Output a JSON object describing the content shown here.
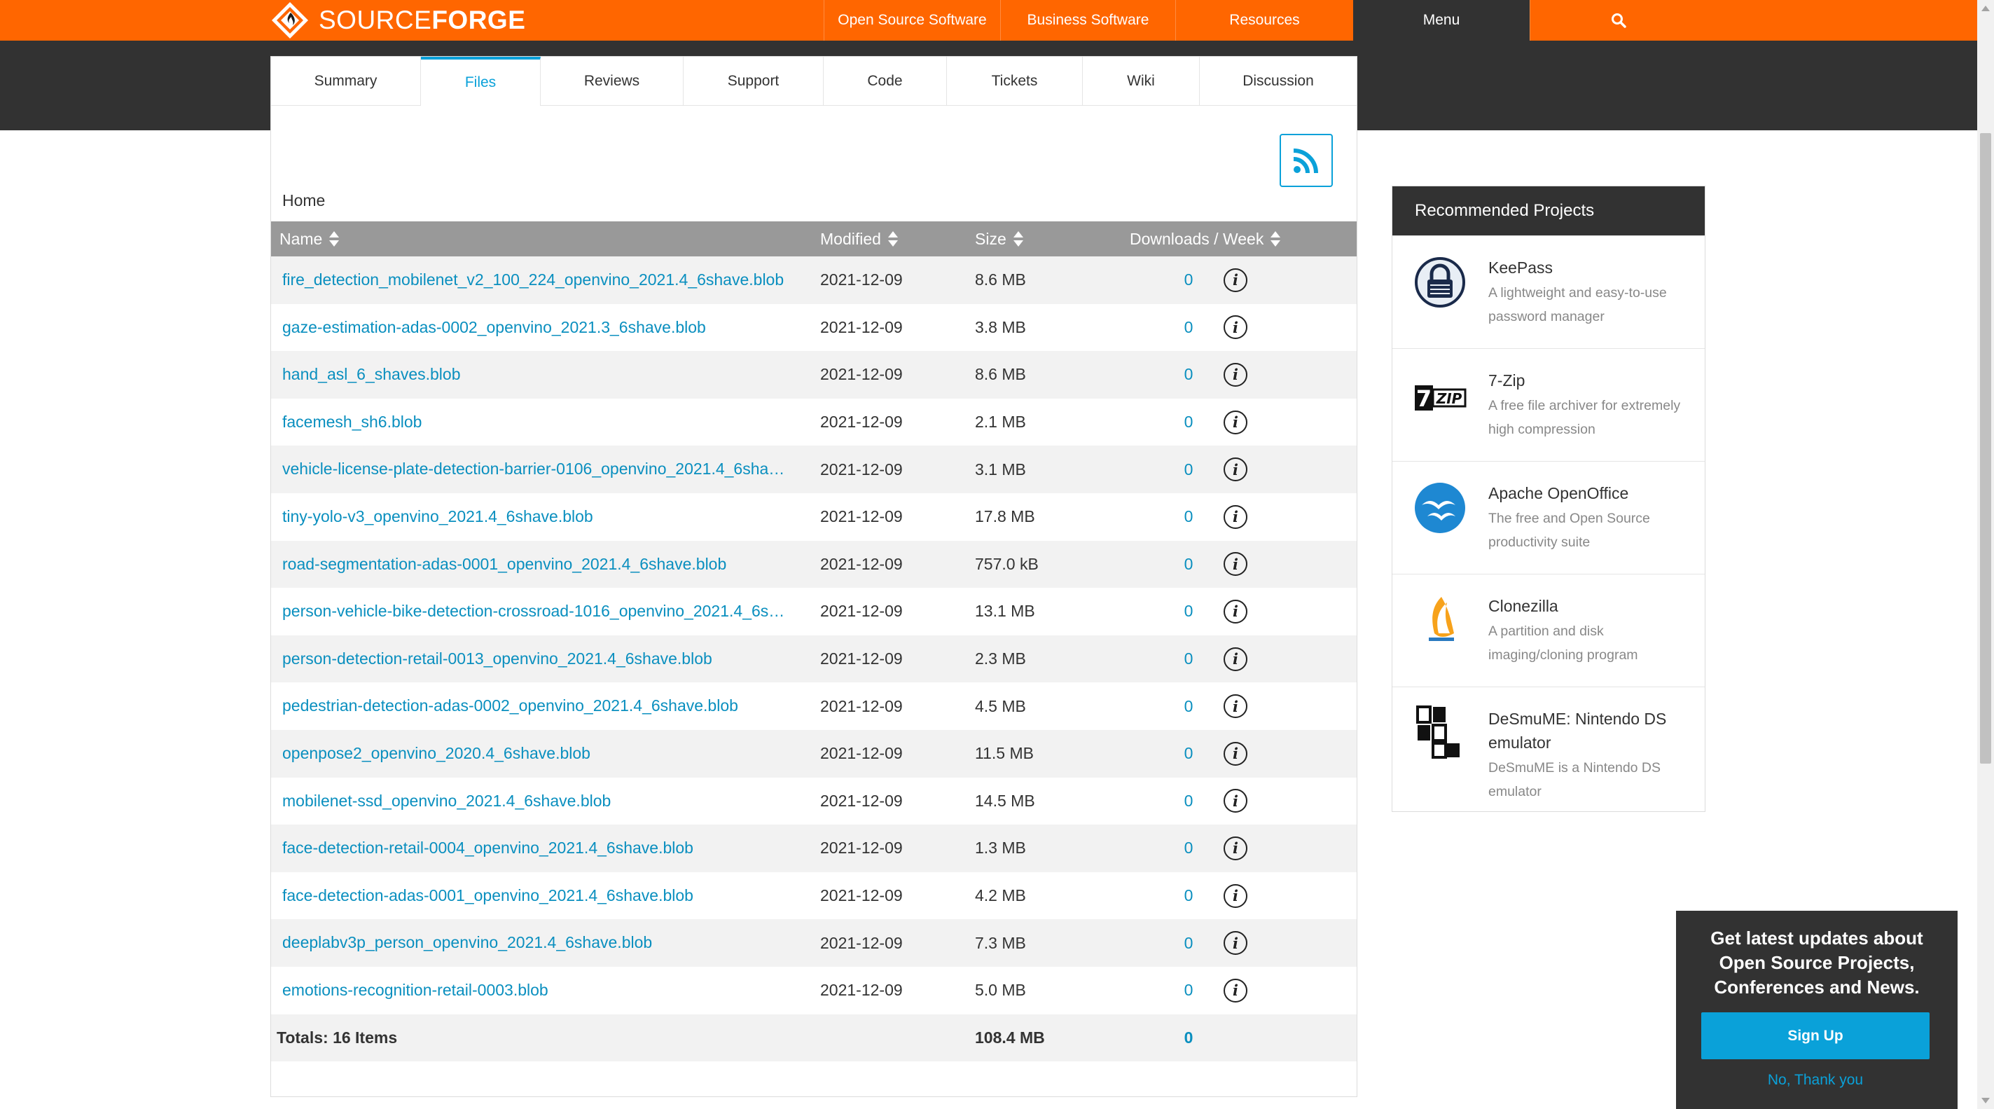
{
  "brand": {
    "source": "SOURCE",
    "forge": "FORGE"
  },
  "topnav": {
    "items": [
      "Open Source Software",
      "Business Software",
      "Resources"
    ],
    "menu": "Menu",
    "search_icon": "search-icon"
  },
  "tabs": [
    "Summary",
    "Files",
    "Reviews",
    "Support",
    "Code",
    "Tickets",
    "Wiki",
    "Discussion"
  ],
  "active_tab": "Files",
  "breadcrumb": "Home",
  "table": {
    "headers": {
      "name": "Name",
      "modified": "Modified",
      "size": "Size",
      "downloads": "Downloads / Week"
    },
    "rows": [
      {
        "name": "fire_detection_mobilenet_v2_100_224_openvino_2021.4_6shave.blob",
        "modified": "2021-12-09",
        "size": "8.6 MB",
        "downloads": "0"
      },
      {
        "name": "gaze-estimation-adas-0002_openvino_2021.3_6shave.blob",
        "modified": "2021-12-09",
        "size": "3.8 MB",
        "downloads": "0"
      },
      {
        "name": "hand_asl_6_shaves.blob",
        "modified": "2021-12-09",
        "size": "8.6 MB",
        "downloads": "0"
      },
      {
        "name": "facemesh_sh6.blob",
        "modified": "2021-12-09",
        "size": "2.1 MB",
        "downloads": "0"
      },
      {
        "name": "vehicle-license-plate-detection-barrier-0106_openvino_2021.4_6sha…",
        "modified": "2021-12-09",
        "size": "3.1 MB",
        "downloads": "0"
      },
      {
        "name": "tiny-yolo-v3_openvino_2021.4_6shave.blob",
        "modified": "2021-12-09",
        "size": "17.8 MB",
        "downloads": "0"
      },
      {
        "name": "road-segmentation-adas-0001_openvino_2021.4_6shave.blob",
        "modified": "2021-12-09",
        "size": "757.0 kB",
        "downloads": "0"
      },
      {
        "name": "person-vehicle-bike-detection-crossroad-1016_openvino_2021.4_6s…",
        "modified": "2021-12-09",
        "size": "13.1 MB",
        "downloads": "0"
      },
      {
        "name": "person-detection-retail-0013_openvino_2021.4_6shave.blob",
        "modified": "2021-12-09",
        "size": "2.3 MB",
        "downloads": "0"
      },
      {
        "name": "pedestrian-detection-adas-0002_openvino_2021.4_6shave.blob",
        "modified": "2021-12-09",
        "size": "4.5 MB",
        "downloads": "0"
      },
      {
        "name": "openpose2_openvino_2020.4_6shave.blob",
        "modified": "2021-12-09",
        "size": "11.5 MB",
        "downloads": "0"
      },
      {
        "name": "mobilenet-ssd_openvino_2021.4_6shave.blob",
        "modified": "2021-12-09",
        "size": "14.5 MB",
        "downloads": "0"
      },
      {
        "name": "face-detection-retail-0004_openvino_2021.4_6shave.blob",
        "modified": "2021-12-09",
        "size": "1.3 MB",
        "downloads": "0"
      },
      {
        "name": "face-detection-adas-0001_openvino_2021.4_6shave.blob",
        "modified": "2021-12-09",
        "size": "4.2 MB",
        "downloads": "0"
      },
      {
        "name": "deeplabv3p_person_openvino_2021.4_6shave.blob",
        "modified": "2021-12-09",
        "size": "7.3 MB",
        "downloads": "0"
      },
      {
        "name": "emotions-recognition-retail-0003.blob",
        "modified": "2021-12-09",
        "size": "5.0 MB",
        "downloads": "0"
      }
    ],
    "totals": {
      "label": "Totals: 16 Items",
      "size": "108.4 MB",
      "downloads": "0"
    }
  },
  "sidebar": {
    "title": "Recommended Projects",
    "projects": [
      {
        "name": "KeePass",
        "desc": "A lightweight and easy-to-use password manager",
        "icon": "keepass-lock-icon"
      },
      {
        "name": "7-Zip",
        "desc": "A free file archiver for extremely high compression",
        "icon": "7zip-logo-icon"
      },
      {
        "name": "Apache OpenOffice",
        "desc": "The free and Open Source productivity suite",
        "icon": "openoffice-gulls-icon"
      },
      {
        "name": "Clonezilla",
        "desc": "A partition and disk imaging/cloning program",
        "icon": "clonezilla-flame-icon"
      },
      {
        "name": "DeSmuME: Nintendo DS emulator",
        "desc": "DeSmuME is a Nintendo DS emulator",
        "icon": "desmume-logo-icon"
      }
    ]
  },
  "newsletter": {
    "title": "Get latest updates about Open Source Projects, Conferences and News.",
    "button": "Sign Up",
    "decline": "No, Thank you"
  },
  "colors": {
    "brand_orange": "#ff6600",
    "dark": "#323232",
    "link_blue": "#0a8fbf",
    "accent_blue": "#0aa1d9",
    "header_gray": "#999999"
  }
}
